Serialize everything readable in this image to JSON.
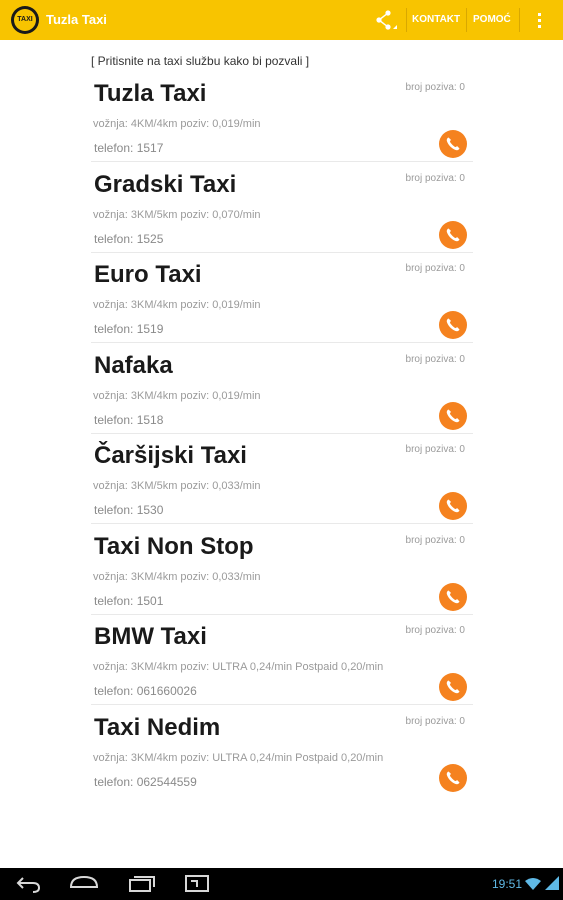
{
  "app": {
    "title": "Tuzla Taxi",
    "logo_text": "TAXI"
  },
  "actions": {
    "kontakt": "KONTAKT",
    "pomoc": "POMOĆ"
  },
  "hint": "[ Pritisnite na taxi službu kako bi pozvali ]",
  "taxis": [
    {
      "name": "Tuzla Taxi",
      "calls": "broj poziva: 0",
      "fare": "vožnja: 4KM/4km poziv: 0,019/min",
      "phone": "telefon: 1517"
    },
    {
      "name": "Gradski Taxi",
      "calls": "broj poziva: 0",
      "fare": "vožnja: 3KM/5km poziv: 0,070/min",
      "phone": "telefon: 1525"
    },
    {
      "name": "Euro Taxi",
      "calls": "broj poziva: 0",
      "fare": "vožnja: 3KM/4km poziv: 0,019/min",
      "phone": "telefon: 1519"
    },
    {
      "name": "Nafaka",
      "calls": "broj poziva: 0",
      "fare": "vožnja: 3KM/4km poziv: 0,019/min",
      "phone": "telefon: 1518"
    },
    {
      "name": "Čaršijski Taxi",
      "calls": "broj poziva: 0",
      "fare": "vožnja: 3KM/5km poziv: 0,033/min",
      "phone": "telefon: 1530"
    },
    {
      "name": "Taxi Non Stop",
      "calls": "broj poziva: 0",
      "fare": "vožnja: 3KM/4km poziv: 0,033/min",
      "phone": "telefon: 1501"
    },
    {
      "name": "BMW Taxi",
      "calls": "broj poziva: 0",
      "fare": "vožnja: 3KM/4km poziv: ULTRA 0,24/min Postpaid 0,20/min",
      "phone": "telefon: 061660026"
    },
    {
      "name": "Taxi Nedim",
      "calls": "broj poziva: 0",
      "fare": "vožnja: 3KM/4km poziv: ULTRA 0,24/min Postpaid 0,20/min",
      "phone": "telefon: 062544559"
    }
  ],
  "status": {
    "time": "19:51"
  },
  "icons": {
    "share": "share-icon",
    "call": "phone-icon",
    "overflow": "overflow-menu-icon"
  },
  "colors": {
    "actionbar": "#f8c400",
    "call_button": "#f5821f",
    "clock": "#5fb9e6"
  }
}
